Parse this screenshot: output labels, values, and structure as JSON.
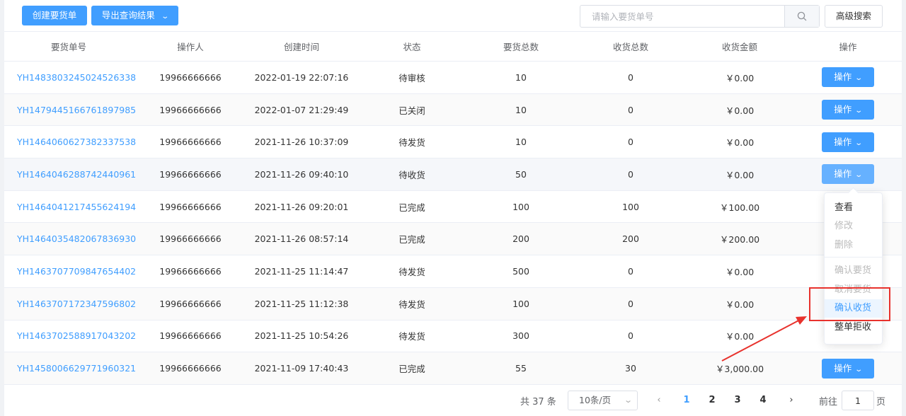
{
  "toolbar": {
    "create_label": "创建要货单",
    "export_label": "导出查询结果",
    "search_placeholder": "请输入要货单号",
    "advanced_label": "高级搜索"
  },
  "columns": [
    "要货单号",
    "操作人",
    "创建时间",
    "状态",
    "要货总数",
    "收货总数",
    "收货金额",
    "操作"
  ],
  "rows": [
    {
      "order_no": "YH1483803245024526338",
      "operator": "19966666666",
      "created": "2022-01-19 22:07:16",
      "status": "待审核",
      "request_total": "10",
      "received_total": "0",
      "amount": "￥0.00",
      "action": "操作"
    },
    {
      "order_no": "YH1479445166761897985",
      "operator": "19966666666",
      "created": "2022-01-07 21:29:49",
      "status": "已关闭",
      "request_total": "10",
      "received_total": "0",
      "amount": "￥0.00",
      "action": "操作"
    },
    {
      "order_no": "YH1464060627382337538",
      "operator": "19966666666",
      "created": "2021-11-26 10:37:09",
      "status": "待发货",
      "request_total": "10",
      "received_total": "0",
      "amount": "￥0.00",
      "action": "操作"
    },
    {
      "order_no": "YH1464046288742440961",
      "operator": "19966666666",
      "created": "2021-11-26 09:40:10",
      "status": "待收货",
      "request_total": "50",
      "received_total": "0",
      "amount": "￥0.00",
      "action": "操作"
    },
    {
      "order_no": "YH1464041217455624194",
      "operator": "19966666666",
      "created": "2021-11-26 09:20:01",
      "status": "已完成",
      "request_total": "100",
      "received_total": "100",
      "amount": "￥100.00",
      "action": ""
    },
    {
      "order_no": "YH1464035482067836930",
      "operator": "19966666666",
      "created": "2021-11-26 08:57:14",
      "status": "已完成",
      "request_total": "200",
      "received_total": "200",
      "amount": "￥200.00",
      "action": ""
    },
    {
      "order_no": "YH1463707709847654402",
      "operator": "19966666666",
      "created": "2021-11-25 11:14:47",
      "status": "待发货",
      "request_total": "500",
      "received_total": "0",
      "amount": "￥0.00",
      "action": ""
    },
    {
      "order_no": "YH1463707172347596802",
      "operator": "19966666666",
      "created": "2021-11-25 11:12:38",
      "status": "待发货",
      "request_total": "100",
      "received_total": "0",
      "amount": "￥0.00",
      "action": ""
    },
    {
      "order_no": "YH1463702588917043202",
      "operator": "19966666666",
      "created": "2021-11-25 10:54:26",
      "status": "待发货",
      "request_total": "300",
      "received_total": "0",
      "amount": "￥0.00",
      "action": ""
    },
    {
      "order_no": "YH1458006629771960321",
      "operator": "19966666666",
      "created": "2021-11-09 17:40:43",
      "status": "已完成",
      "request_total": "55",
      "received_total": "30",
      "amount": "￥3,000.00",
      "action": "操作"
    }
  ],
  "dropdown": {
    "items": [
      {
        "label": "查看",
        "state": "enabled"
      },
      {
        "label": "修改",
        "state": "disabled"
      },
      {
        "label": "删除",
        "state": "disabled"
      },
      {
        "label": "确认要货",
        "state": "disabled"
      },
      {
        "label": "取消要货",
        "state": "disabled"
      },
      {
        "label": "确认收货",
        "state": "highlight"
      },
      {
        "label": "整单拒收",
        "state": "enabled"
      }
    ]
  },
  "pagination": {
    "total": "共 37 条",
    "page_size": "10条/页",
    "pages": [
      "1",
      "2",
      "3",
      "4"
    ],
    "current": "1",
    "goto_prefix": "前往",
    "goto_value": "1",
    "goto_suffix": "页"
  },
  "colors": {
    "primary": "#409eff",
    "highlight_border": "#e8322d",
    "row_hover": "#f5f7fa"
  },
  "icons": {
    "search": "search-icon",
    "chevron": "chevron-down-icon",
    "prev": "chevron-left-icon",
    "next": "chevron-right-icon"
  }
}
